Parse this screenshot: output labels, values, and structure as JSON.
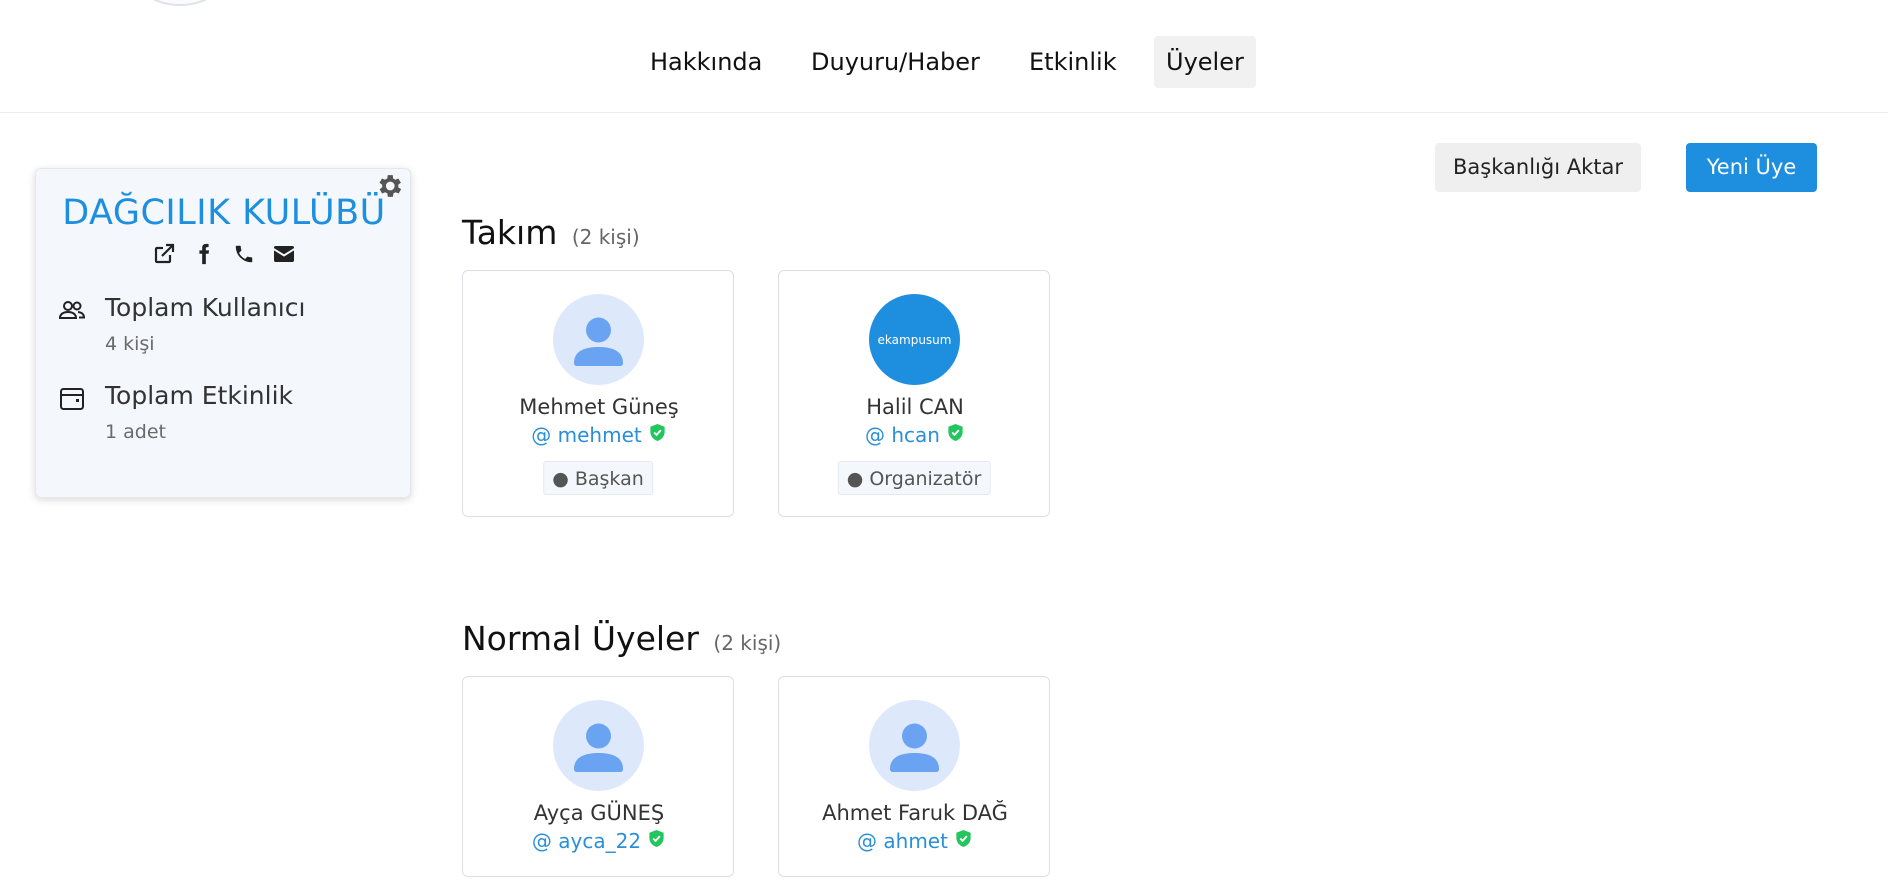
{
  "nav": {
    "items": [
      {
        "label": "Hakkında"
      },
      {
        "label": "Duyuru/Haber"
      },
      {
        "label": "Etkinlik"
      },
      {
        "label": "Üyeler",
        "active": true
      }
    ]
  },
  "club": {
    "name": "DAĞCILIK KULÜBÜ",
    "social_icons": [
      "external-link-icon",
      "facebook-icon",
      "phone-icon",
      "email-icon"
    ],
    "stats": [
      {
        "icon": "users-icon",
        "label": "Toplam Kullanıcı",
        "value": "4 kişi"
      },
      {
        "icon": "calendar-icon",
        "label": "Toplam Etkinlik",
        "value": "1 adet"
      }
    ]
  },
  "actions": {
    "transfer_label": "Başkanlığı Aktar",
    "new_member_label": "Yeni Üye"
  },
  "team": {
    "title": "Takım",
    "count": "(2 kişi)",
    "members": [
      {
        "name": "Mehmet Güneş",
        "username": "@ mehmet",
        "role": "Başkan",
        "avatar": "default"
      },
      {
        "name": "Halil CAN",
        "username": "@ hcan",
        "role": "Organizatör",
        "avatar": "ekampusum"
      }
    ]
  },
  "normal": {
    "title": "Normal Üyeler",
    "count": "(2 kişi)",
    "members": [
      {
        "name": "Ayça GÜNEŞ",
        "username": "@ ayca_22",
        "avatar": "default"
      },
      {
        "name": "Ahmet Faruk DAĞ",
        "username": "@ ahmet",
        "avatar": "default"
      }
    ]
  },
  "brand_logo_text": "ekampusum",
  "colors": {
    "accent": "#1e8fde",
    "verified": "#22c55e",
    "avatar_bg": "#dde9fb",
    "avatar_fg": "#6aa3f2"
  }
}
